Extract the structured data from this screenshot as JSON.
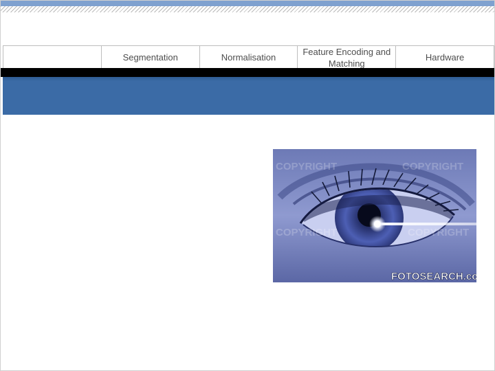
{
  "nav": {
    "tabs": [
      {
        "label": ""
      },
      {
        "label": "Segmentation"
      },
      {
        "label": "Normalisation"
      },
      {
        "label": "Feature Encoding and Matching"
      },
      {
        "label": "Hardware"
      }
    ]
  },
  "photo": {
    "watermark": "COPYRIGHT",
    "credit": "FOTOSEARCH.com"
  },
  "colors": {
    "accent_blue": "#3b6ba6",
    "stripe_blue": "#7fa1cf",
    "band_black": "#000000"
  },
  "icons": {
    "photo": "eye-photo"
  }
}
